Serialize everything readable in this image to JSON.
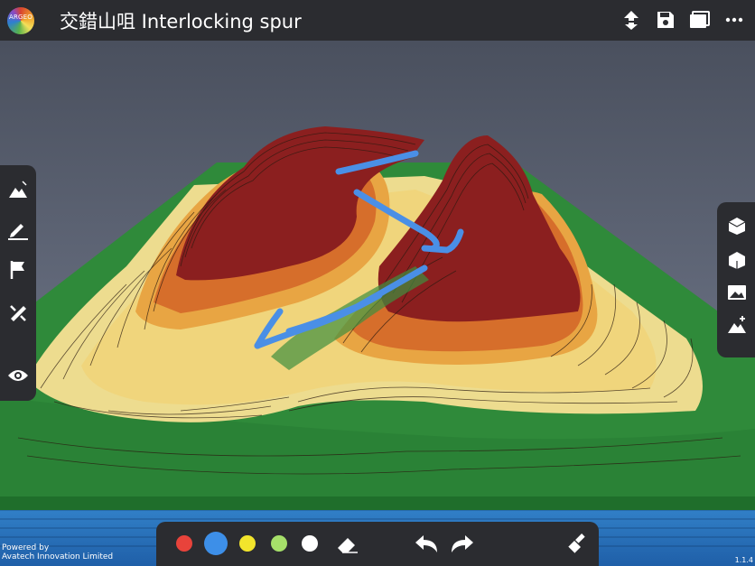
{
  "app": {
    "logo_text": "ARGEO",
    "title": "交錯山咀 Interlocking spur"
  },
  "toolbar_top": [
    "navigate-icon",
    "save-icon",
    "folder-icon",
    "more-icon"
  ],
  "toolbar_left": [
    "terrain-icon",
    "pen-icon",
    "flag-icon",
    "measure-icon",
    "eye-icon"
  ],
  "toolbar_right": [
    "cube-top-icon",
    "cube-side-icon",
    "image-icon",
    "terrain-add-icon"
  ],
  "pen_colors": [
    {
      "name": "red",
      "color": "#e8433b",
      "selected": false
    },
    {
      "name": "blue",
      "color": "#3d8fe8",
      "selected": true
    },
    {
      "name": "yellow",
      "color": "#f2e52c",
      "selected": false
    },
    {
      "name": "green",
      "color": "#a6e06a",
      "selected": false
    },
    {
      "name": "white",
      "color": "#ffffff",
      "selected": false
    }
  ],
  "drawing_tools": [
    "eraser-icon",
    "undo-icon",
    "redo-icon",
    "clear-icon"
  ],
  "footer": {
    "powered_by": "Powered by",
    "company": "Avatech Innovation Limited",
    "version": "1.1.4"
  }
}
